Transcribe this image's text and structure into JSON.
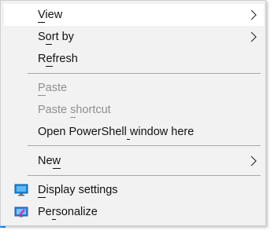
{
  "menu": {
    "items": [
      {
        "label": "View",
        "accel_index": 0,
        "disabled": false,
        "has_submenu": true,
        "highlighted": true
      },
      {
        "label": "Sort by",
        "accel_index": 1,
        "disabled": false,
        "has_submenu": true
      },
      {
        "label": "Refresh",
        "accel_index": 1,
        "disabled": false,
        "has_submenu": false
      },
      {
        "label": "Paste",
        "accel_index": 0,
        "disabled": true,
        "has_submenu": false
      },
      {
        "label": "Paste shortcut",
        "accel_index": 6,
        "disabled": true,
        "has_submenu": false
      },
      {
        "label": "Open PowerShell window here",
        "accel_index": 15,
        "disabled": false,
        "has_submenu": false
      },
      {
        "label": "New",
        "accel_index": 2,
        "disabled": false,
        "has_submenu": true
      },
      {
        "label": "Display settings",
        "accel_index": 0,
        "disabled": false,
        "has_submenu": false,
        "icon": "display-settings-icon"
      },
      {
        "label": "Personalize",
        "accel_index": 2,
        "disabled": false,
        "has_submenu": false,
        "icon": "personalize-icon"
      }
    ]
  },
  "colors": {
    "menu_background": "#f2f2f2",
    "highlight": "#ffffff",
    "disabled_text": "#8f8f8f",
    "separator": "#a7a7a7",
    "accent_edge": "#1e90ff"
  }
}
